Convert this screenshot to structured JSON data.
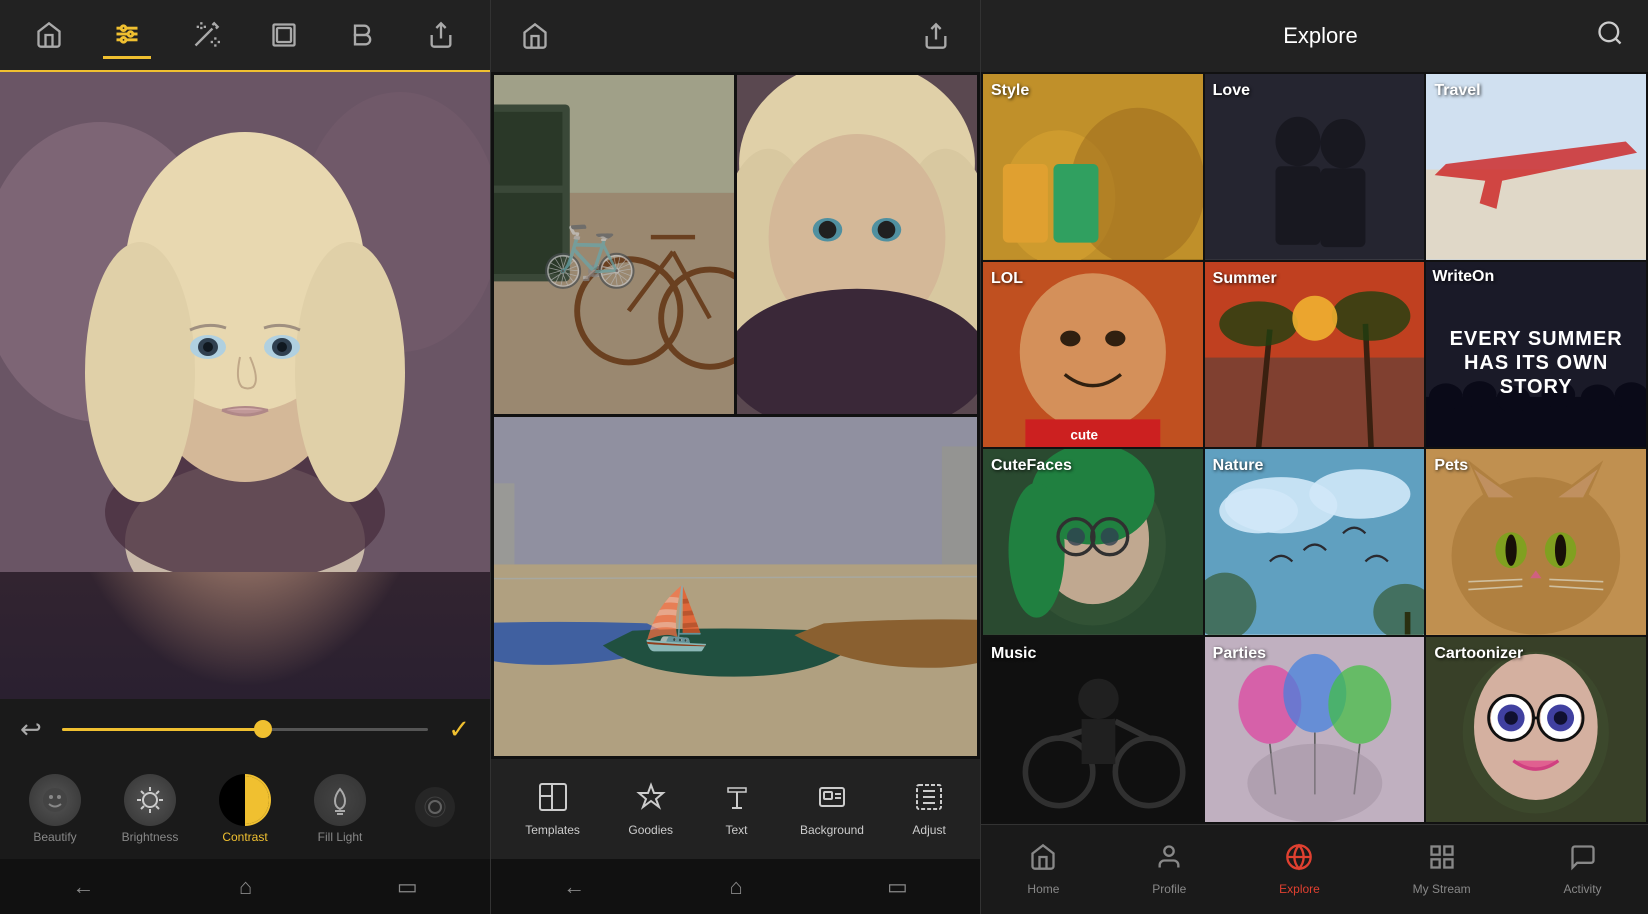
{
  "left": {
    "toolbar": {
      "icons": [
        "home",
        "sliders",
        "magic-wand",
        "frame",
        "bold-b",
        "share"
      ]
    },
    "controls": {
      "undo_label": "↩",
      "confirm_label": "✓"
    },
    "tools": [
      {
        "id": "beautify",
        "label": "Beautify",
        "icon": "😊",
        "selected": false
      },
      {
        "id": "brightness",
        "label": "Brightness",
        "icon": "☀",
        "selected": false
      },
      {
        "id": "contrast",
        "label": "Contrast",
        "icon": "◑",
        "selected": true
      },
      {
        "id": "filllight",
        "label": "Fill Light",
        "icon": "💡",
        "selected": false
      }
    ],
    "nav": [
      "←",
      "⌂",
      "▭"
    ]
  },
  "middle": {
    "toolbar": {
      "home_icon": "⌂",
      "share_icon": "↗"
    },
    "bottom_tabs": [
      {
        "id": "templates",
        "label": "Templates",
        "icon": "⊞"
      },
      {
        "id": "goodies",
        "label": "Goodies",
        "icon": "⬡"
      },
      {
        "id": "text",
        "label": "Text",
        "icon": "B"
      },
      {
        "id": "background",
        "label": "Background",
        "icon": "▭"
      },
      {
        "id": "adjust",
        "label": "Adjust",
        "icon": "⋯"
      }
    ],
    "nav": [
      "←",
      "⌂",
      "▭"
    ]
  },
  "right": {
    "header": {
      "title": "Explore",
      "search_icon": "🔍"
    },
    "categories": [
      {
        "id": "style",
        "label": "Style",
        "class": "cat-style"
      },
      {
        "id": "love",
        "label": "Love",
        "class": "cat-love"
      },
      {
        "id": "travel",
        "label": "Travel",
        "class": "cat-travel"
      },
      {
        "id": "lol",
        "label": "LOL",
        "class": "cat-lol"
      },
      {
        "id": "summer",
        "label": "Summer",
        "class": "cat-summer"
      },
      {
        "id": "writeon",
        "label": "WriteOn",
        "class": "cat-writeon",
        "overlay_text": "EVERY SUMMER HAS ITS OWN STORY"
      },
      {
        "id": "cutefaces",
        "label": "CuteFaces",
        "class": "cat-cutefaces"
      },
      {
        "id": "nature",
        "label": "Nature",
        "class": "cat-nature"
      },
      {
        "id": "pets",
        "label": "Pets",
        "class": "cat-pets"
      },
      {
        "id": "music",
        "label": "Music",
        "class": "cat-music"
      },
      {
        "id": "parties",
        "label": "Parties",
        "class": "cat-parties"
      },
      {
        "id": "cartoonizer",
        "label": "Cartoonizer",
        "class": "cat-cartoonizer"
      }
    ],
    "bottom_nav": [
      {
        "id": "home",
        "label": "Home",
        "icon": "⌂",
        "active": false
      },
      {
        "id": "profile",
        "label": "Profile",
        "icon": "👤",
        "active": false
      },
      {
        "id": "explore",
        "label": "Explore",
        "icon": "🌐",
        "active": true
      },
      {
        "id": "mystream",
        "label": "My Stream",
        "icon": "⊞",
        "active": false
      },
      {
        "id": "activity",
        "label": "Activity",
        "icon": "💬",
        "active": false
      }
    ]
  }
}
